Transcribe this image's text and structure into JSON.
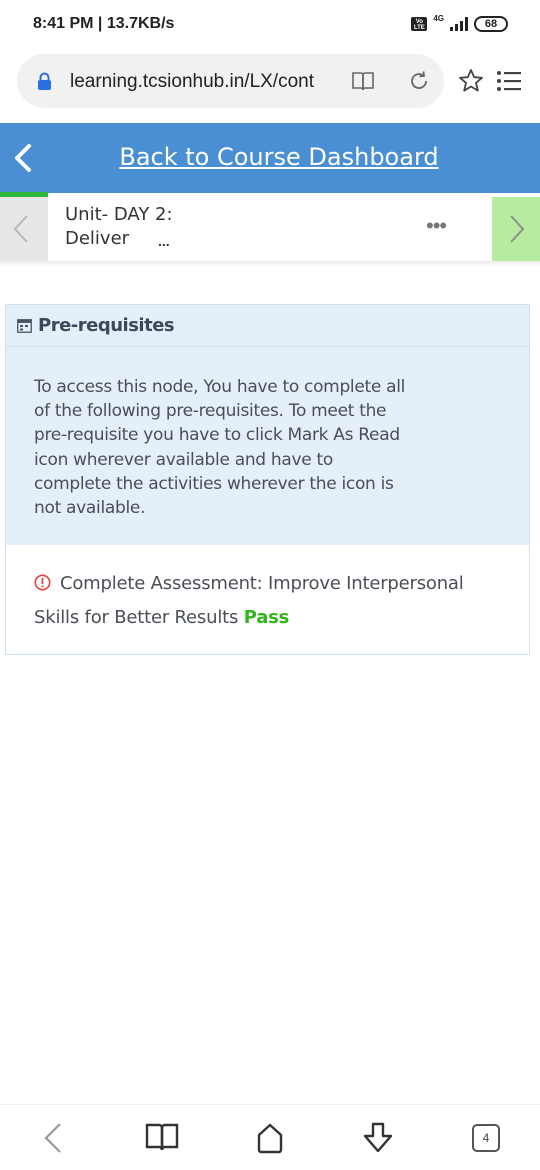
{
  "status_bar": {
    "time_speed": "8:41 PM | 13.7KB/s",
    "volte": "Vo LTE",
    "network": "4G",
    "battery": "68"
  },
  "browser": {
    "url": "learning.tcsionhub.in/LX/cont",
    "icons": [
      "lock-icon",
      "book-icon",
      "reload-icon",
      "star-icon",
      "menu-icon"
    ]
  },
  "header": {
    "back_link": "Back to Course Dashboard",
    "accent_color": "#4a8fd3"
  },
  "unit_nav": {
    "title": "Unit- DAY 2: Deliver",
    "ellipsis": "...",
    "more": "•••",
    "progress_color": "#2db83d",
    "next_color": "#b7eb9e"
  },
  "prerequisites": {
    "title": "Pre-requisites",
    "description": "To access this node, You have to complete all of the following pre-requisites. To meet the pre-requisite you have to click Mark As Read icon wherever available and have to complete the activities wherever the icon is not available.",
    "items": [
      {
        "text": "Complete Assessment: Improve Interpersonal Skills for Better Results",
        "status": "Pass",
        "status_color": "#35b41d"
      }
    ]
  },
  "bottom_nav": {
    "tab_count": "4"
  }
}
